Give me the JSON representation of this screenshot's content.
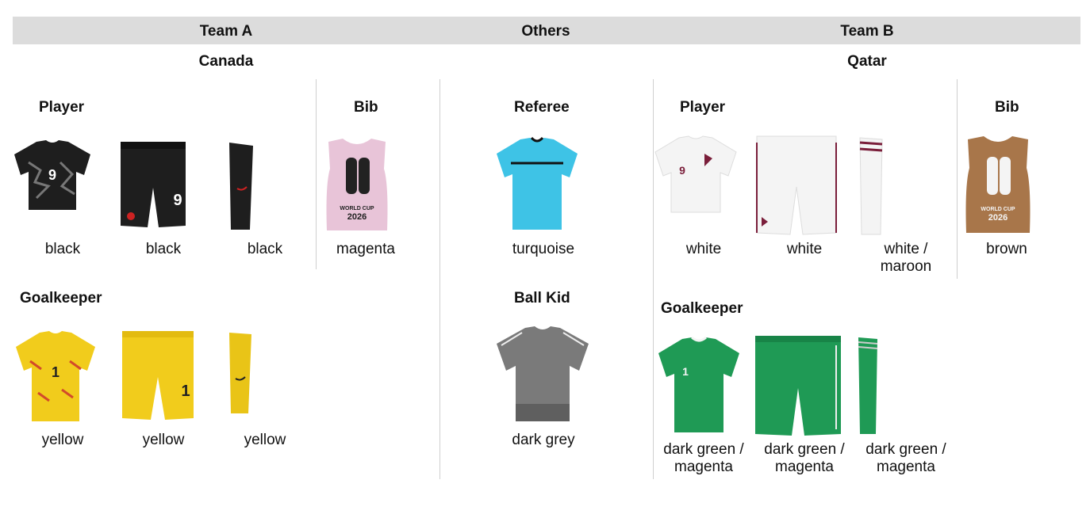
{
  "header": {
    "team_a": "Team A",
    "others": "Others",
    "team_b": "Team B"
  },
  "team_a": {
    "country": "Canada",
    "player": {
      "title": "Player",
      "items": [
        {
          "name": "jersey",
          "color_label": "black",
          "color": "#1e1e1e"
        },
        {
          "name": "shorts",
          "color_label": "black",
          "color": "#1e1e1e"
        },
        {
          "name": "socks",
          "color_label": "black",
          "color": "#1e1e1e"
        }
      ]
    },
    "bib": {
      "title": "Bib",
      "color_label": "magenta",
      "color": "#e8c4d8"
    },
    "goalkeeper": {
      "title": "Goalkeeper",
      "items": [
        {
          "name": "jersey",
          "color_label": "yellow",
          "color": "#f1cc1c"
        },
        {
          "name": "shorts",
          "color_label": "yellow",
          "color": "#f1cc1c"
        },
        {
          "name": "socks",
          "color_label": "yellow",
          "color": "#f1cc1c"
        }
      ]
    }
  },
  "others": {
    "referee": {
      "title": "Referee",
      "color_label": "turquoise",
      "color": "#3ec3e6"
    },
    "ball_kid": {
      "title": "Ball Kid",
      "color_label": "dark grey",
      "color": "#7a7a7a"
    }
  },
  "team_b": {
    "country": "Qatar",
    "player": {
      "title": "Player",
      "items": [
        {
          "name": "jersey",
          "color_label": "white",
          "color": "#f4f4f4"
        },
        {
          "name": "shorts",
          "color_label": "white",
          "color": "#f4f4f4"
        },
        {
          "name": "socks",
          "color_label_1": "white /",
          "color_label_2": "maroon",
          "color": "#f4f4f4"
        }
      ]
    },
    "bib": {
      "title": "Bib",
      "color_label": "brown",
      "color": "#a8764a"
    },
    "goalkeeper": {
      "title": "Goalkeeper",
      "items": [
        {
          "name": "jersey",
          "color_label_1": "dark green /",
          "color_label_2": "magenta",
          "color": "#1f9a55"
        },
        {
          "name": "shorts",
          "color_label_1": "dark green /",
          "color_label_2": "magenta",
          "color": "#1f9a55"
        },
        {
          "name": "socks",
          "color_label_1": "dark green /",
          "color_label_2": "magenta",
          "color": "#1f9a55"
        }
      ]
    }
  }
}
